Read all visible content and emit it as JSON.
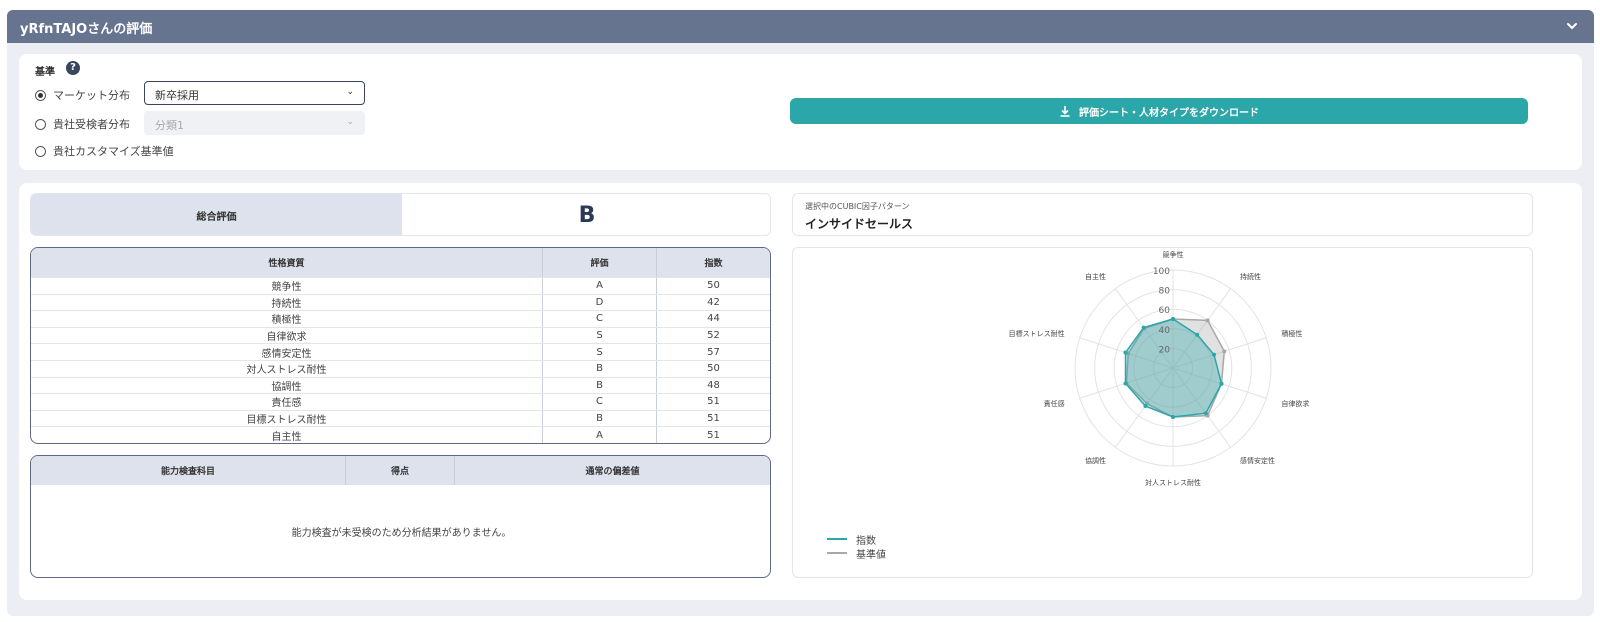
{
  "header": {
    "title": "yRfnTAJOさんの評価",
    "collapse_icon": "chevron-down-icon"
  },
  "criteria": {
    "label": "基準",
    "help_icon": "question-circle-icon",
    "options": [
      {
        "label": "マーケット分布",
        "selected": true,
        "select_value": "新卒採用",
        "select_enabled": true
      },
      {
        "label": "貴社受検者分布",
        "selected": false,
        "select_value": "分類1",
        "select_enabled": false
      },
      {
        "label": "貴社カスタマイズ基準値",
        "selected": false
      }
    ]
  },
  "download_button": {
    "label": "評価シート・人材タイプをダウンロード",
    "icon": "download-icon"
  },
  "overall": {
    "label": "総合評価",
    "grade": "B"
  },
  "trait_table": {
    "headers": [
      "性格資質",
      "評価",
      "指数"
    ],
    "rows": [
      [
        "競争性",
        "A",
        "50"
      ],
      [
        "持続性",
        "D",
        "42"
      ],
      [
        "積極性",
        "C",
        "44"
      ],
      [
        "自律欲求",
        "S",
        "52"
      ],
      [
        "感情安定性",
        "S",
        "57"
      ],
      [
        "対人ストレス耐性",
        "B",
        "50"
      ],
      [
        "協調性",
        "B",
        "48"
      ],
      [
        "責任感",
        "C",
        "51"
      ],
      [
        "目標ストレス耐性",
        "B",
        "51"
      ],
      [
        "自主性",
        "A",
        "51"
      ]
    ]
  },
  "ability_table": {
    "headers": [
      "能力検査科目",
      "得点",
      "通常の偏差値"
    ],
    "empty_message": "能力検査が未受検のため分析結果がありません。"
  },
  "pattern": {
    "sublabel": "選択中のCUBIC因子パターン",
    "name": "インサイドセールス"
  },
  "chart_data": {
    "type": "radar",
    "categories": [
      "競争性",
      "持続性",
      "積極性",
      "自律欲求",
      "感情安定性",
      "対人ストレス耐性",
      "協調性",
      "責任感",
      "目標ストレス耐性",
      "自主性"
    ],
    "ticks": [
      "20",
      "40",
      "60",
      "80",
      "100"
    ],
    "range": [
      0,
      100
    ],
    "series": [
      {
        "name": "指数",
        "color": "#2ba6a9",
        "values": [
          50,
          42,
          44,
          52,
          57,
          50,
          48,
          51,
          51,
          51
        ]
      },
      {
        "name": "基準値",
        "color": "#a8a8a8",
        "values": [
          50,
          60,
          55,
          52,
          60,
          50,
          45,
          50,
          48,
          50
        ]
      }
    ],
    "legend_position": "bottom-left"
  }
}
